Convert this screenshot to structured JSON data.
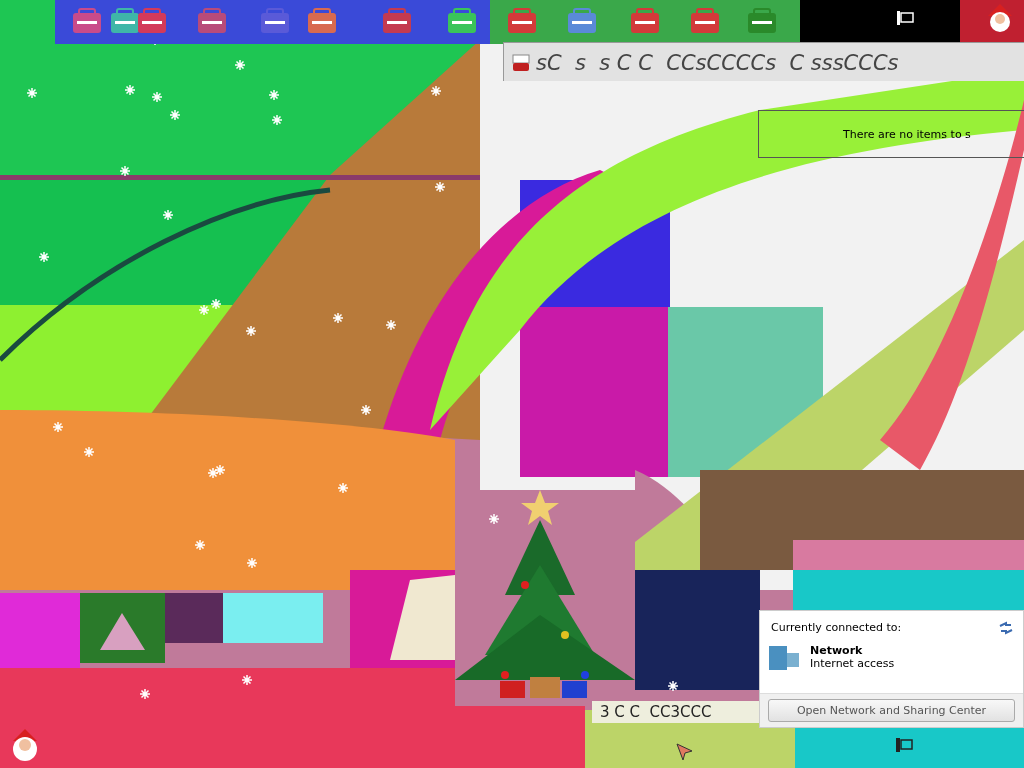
{
  "window": {
    "title": "sC  s  s C C  CCsCCCCs  C sssCCCs",
    "empty_message": "There are no items to s"
  },
  "network_popup": {
    "heading": "Currently connected to:",
    "network_name": "Network",
    "network_status": "Internet access",
    "button": "Open Network and Sharing Center"
  },
  "partial_window": {
    "title": "3 C C  CC3CCC"
  }
}
